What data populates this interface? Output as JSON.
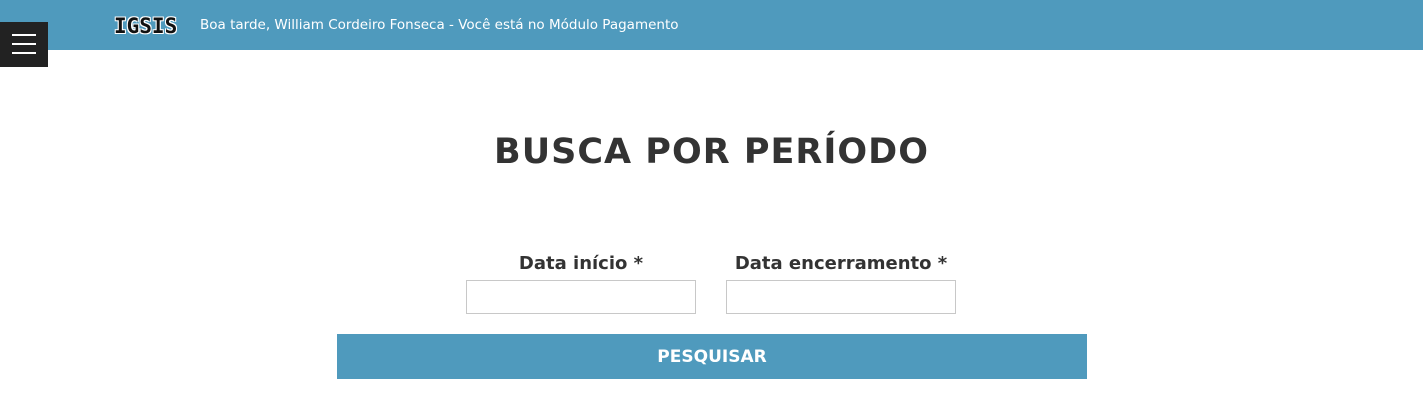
{
  "header": {
    "brand": "IGSIS",
    "greeting": "Boa tarde, William Cordeiro Fonseca - Você está no Módulo Pagamento",
    "menu_icon": "hamburger-menu-icon",
    "bar_color": "#4f9abd"
  },
  "main": {
    "title": "BUSCA POR PERÍODO",
    "fields": {
      "start_label": "Data início *",
      "start_value": "",
      "end_label": "Data encerramento *",
      "end_value": ""
    },
    "search_button_label": "PESQUISAR",
    "button_color": "#4f9abd"
  }
}
